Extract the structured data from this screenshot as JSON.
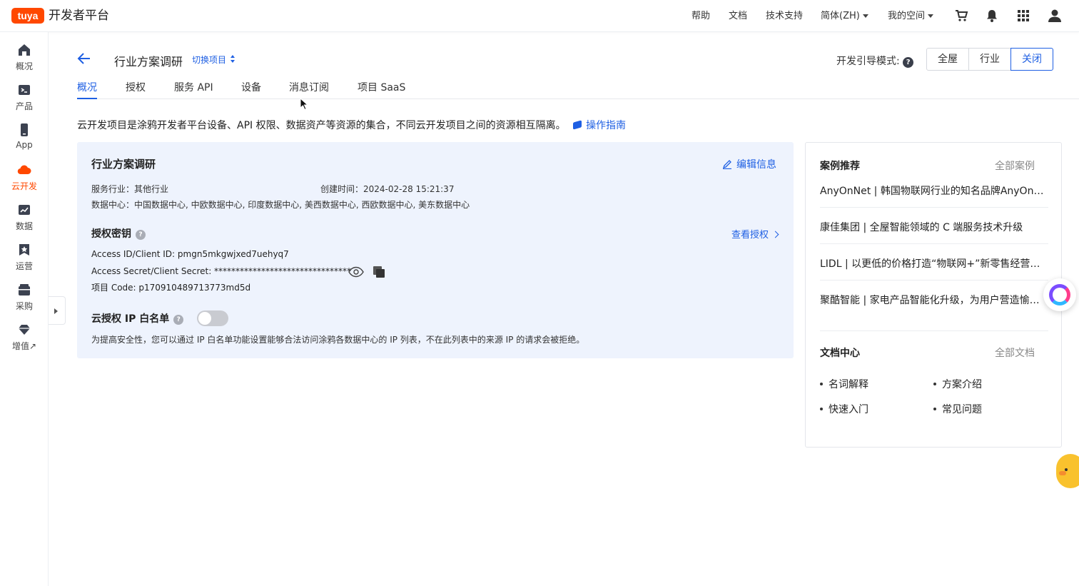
{
  "topbar": {
    "logo_text": "tuya",
    "brand": "开发者平台",
    "nav": {
      "help": "帮助",
      "docs": "文档",
      "support": "技术支持",
      "language": "简体(ZH)",
      "space": "我的空间"
    },
    "icons": [
      "cart-icon",
      "bell-icon",
      "apps-grid-icon",
      "user-icon"
    ]
  },
  "sidebar": {
    "items": [
      {
        "label": "概况",
        "icon": "home-icon"
      },
      {
        "label": "产品",
        "icon": "terminal-icon"
      },
      {
        "label": "App",
        "icon": "phone-icon"
      },
      {
        "label": "云开发",
        "icon": "cloud-icon",
        "active": true
      },
      {
        "label": "数据",
        "icon": "chart-icon"
      },
      {
        "label": "运营",
        "icon": "badge-icon"
      },
      {
        "label": "采购",
        "icon": "box-icon"
      },
      {
        "label": "增值",
        "icon": "diamond-icon",
        "suffix": "↗"
      }
    ]
  },
  "header": {
    "title": "行业方案调研",
    "switch_project": "切换项目",
    "guide_mode_label": "开发引导模式:",
    "guide_modes": [
      "全屋",
      "行业",
      "关闭"
    ],
    "guide_mode_selected": "关闭"
  },
  "tabs": [
    "概况",
    "授权",
    "服务 API",
    "设备",
    "消息订阅",
    "项目 SaaS"
  ],
  "active_tab": "概况",
  "intro": {
    "text": "云开发项目是涂鸦开发者平台设备、API 权限、数据资产等资源的集合，不同云开发项目之间的资源相互隔离。",
    "link": "操作指南"
  },
  "project": {
    "name": "行业方案调研",
    "edit_label": "编辑信息",
    "industry": "服务行业：其他行业",
    "created": "创建时间：2024-02-28 15:21:37",
    "data_centers": "数据中心：中国数据中心, 中欧数据中心, 印度数据中心, 美西数据中心, 西欧数据中心, 美东数据中心"
  },
  "auth": {
    "title": "授权密钥",
    "view_link": "查看授权",
    "access_id": "Access ID/Client ID: pmgn5mkgwjxed7uehyq7",
    "access_secret": "Access Secret/Client Secret: ********************************",
    "project_code": "项目 Code: p170910489713773md5d"
  },
  "ip_whitelist": {
    "title": "云授权 IP 白名单",
    "enabled": false,
    "note": "为提高安全性，您可以通过 IP 白名单功能设置能够合法访问涂鸦各数据中心的 IP 列表，不在此列表中的来源 IP 的请求会被拒绝。"
  },
  "cases": {
    "title": "案例推荐",
    "more": "全部案例",
    "items": [
      "AnyOnNet | 韩国物联网行业的知名品牌AnyOnNe...",
      "康佳集团 | 全屋智能领域的 C 端服务技术升级",
      "LIDL | 以更低的价格打造“物联网+”新零售经营道路",
      "聚酷智能 | 家电产品智能化升级，为用户营造愉悦..."
    ]
  },
  "docs": {
    "title": "文档中心",
    "more": "全部文档",
    "items": [
      "名词解释",
      "方案介绍",
      "快速入门",
      "常见问题"
    ]
  },
  "colors": {
    "brand": "#ff4800",
    "link": "#1e5fe3",
    "card_bg": "#eef3fd"
  }
}
